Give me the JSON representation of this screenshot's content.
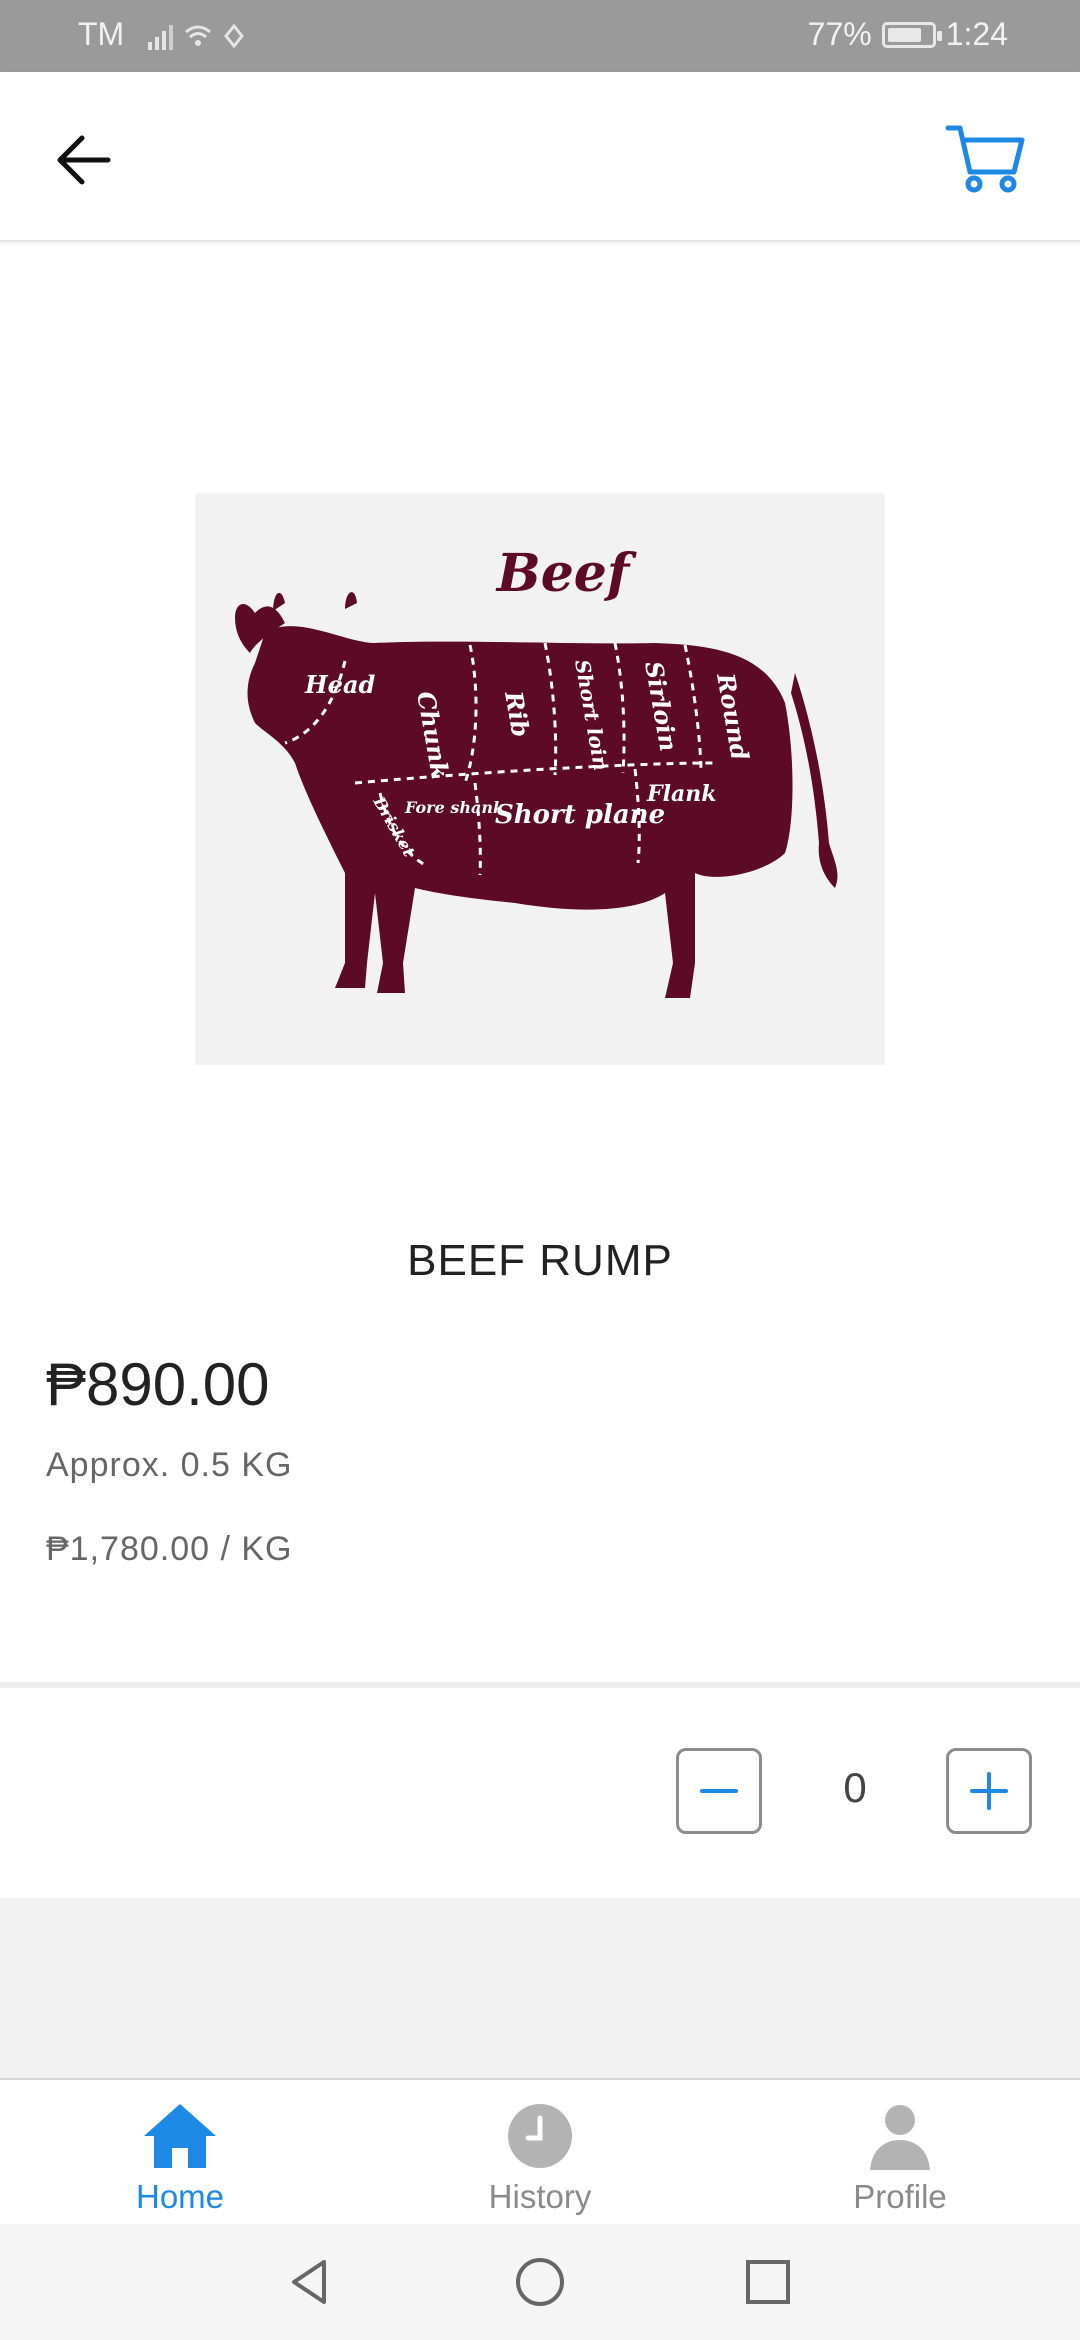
{
  "status_bar": {
    "carrier": "TM",
    "battery": "77%",
    "time": "1:24"
  },
  "app_bar": {
    "back_icon": "arrow-left-icon",
    "cart_icon": "shopping-cart-icon",
    "accent": "#1E88E5"
  },
  "product": {
    "image_text": {
      "title": "Beef",
      "cuts": [
        "Head",
        "Chunk",
        "Rib",
        "Short loin",
        "Sirloin",
        "Round",
        "Brisket",
        "Fore shank",
        "Short plane",
        "Flank"
      ]
    },
    "name": "BEEF RUMP",
    "price": "₱890.00",
    "approx_weight": "Approx. 0.5 KG",
    "price_per_kg": "₱1,780.00 / KG"
  },
  "quantity": {
    "value": "0",
    "minus_icon": "minus-icon",
    "plus_icon": "plus-icon"
  },
  "bottom_nav": {
    "items": [
      {
        "label": "Home",
        "icon": "home-icon",
        "active": true
      },
      {
        "label": "History",
        "icon": "clock-icon",
        "active": false
      },
      {
        "label": "Profile",
        "icon": "user-icon",
        "active": false
      }
    ]
  },
  "colors": {
    "status_bar": "#9A9A9A",
    "accent": "#1E88E5",
    "cow": "#5C0A26",
    "image_bg": "#F2F2F2"
  }
}
